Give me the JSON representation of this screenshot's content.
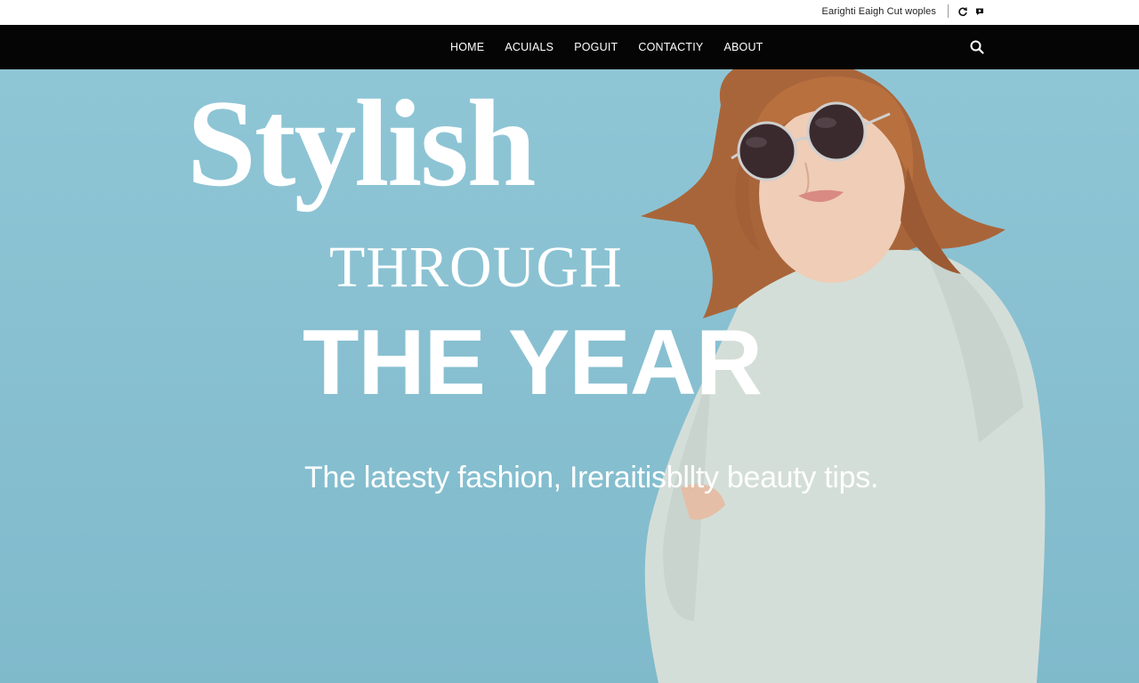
{
  "utility_bar": {
    "text": "Earighti Eaigh Cut woples",
    "icons": [
      "refresh-icon",
      "chat-icon"
    ]
  },
  "nav": {
    "links": [
      {
        "label": "HOME"
      },
      {
        "label": "ACUIALS"
      },
      {
        "label": "POGUIT"
      },
      {
        "label": "CONTACTIY"
      },
      {
        "label": "ABOUT"
      }
    ],
    "search_icon": "search-icon"
  },
  "hero": {
    "headline_1": "Stylish",
    "headline_2": "THROUGH",
    "headline_3": "THE YEAR",
    "tagline": "The latesty fashion, Ireraitisbllty beauty tips."
  },
  "colors": {
    "nav_background": "#050505",
    "hero_background": "#8fc6d6",
    "sweater": "#d3ddd7",
    "hair": "#b06a3a",
    "text_on_hero": "#ffffff"
  }
}
